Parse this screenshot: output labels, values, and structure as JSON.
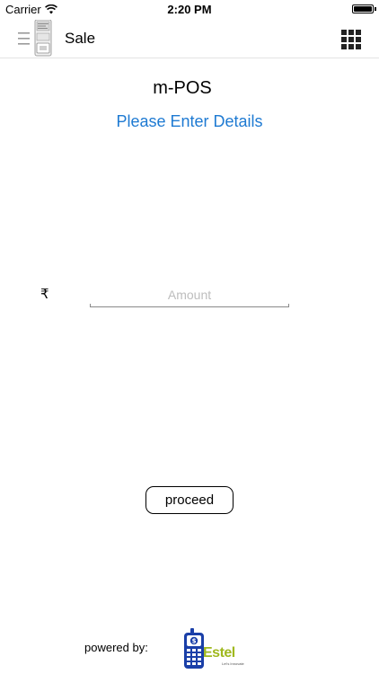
{
  "status_bar": {
    "carrier": "Carrier",
    "time": "2:20 PM",
    "battery_level": 1.0
  },
  "nav": {
    "title": "Sale",
    "menu_icon": "hamburger-with-pos-terminal-icon",
    "grid_icon": "grid-icon"
  },
  "content": {
    "app_title": "m-POS",
    "subtitle": "Please Enter Details",
    "currency_symbol": "₹",
    "amount_placeholder": "Amount",
    "amount_value": "",
    "proceed_label": "proceed"
  },
  "footer": {
    "powered_by": "powered by:",
    "brand_name": "Estel",
    "brand_tagline": "Let's Innovate"
  },
  "colors": {
    "accent": "#1e7ad2",
    "brand_green": "#9fb81e",
    "brand_blue": "#1a3fa8"
  }
}
